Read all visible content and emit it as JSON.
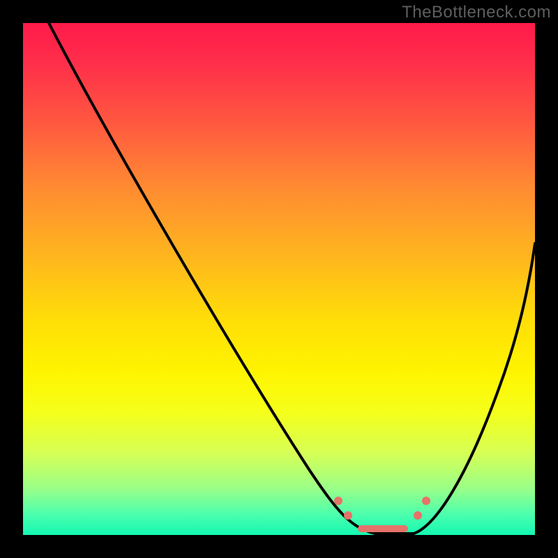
{
  "watermark": "TheBottleneck.com",
  "colors": {
    "frame": "#000000",
    "curve": "#000000",
    "marker": "#e57369",
    "watermark": "#5e5e5e"
  },
  "chart_data": {
    "type": "line",
    "title": "",
    "xlabel": "",
    "ylabel": "",
    "xlim": [
      0,
      100
    ],
    "ylim": [
      0,
      100
    ],
    "grid": false,
    "series": [
      {
        "name": "left-curve",
        "x": [
          5,
          12,
          20,
          28,
          36,
          44,
          52,
          58,
          62,
          66,
          70
        ],
        "y": [
          100,
          88,
          75,
          62,
          49,
          35,
          22,
          12,
          6,
          2,
          0
        ]
      },
      {
        "name": "right-curve",
        "x": [
          76,
          80,
          84,
          88,
          92,
          96,
          100
        ],
        "y": [
          0,
          4,
          12,
          22,
          33,
          45,
          57
        ]
      }
    ],
    "annotations": [
      {
        "name": "valley-marker-left-outer",
        "type": "dot",
        "x": 61.5,
        "y": 7
      },
      {
        "name": "valley-marker-left-inner",
        "type": "dot",
        "x": 63.5,
        "y": 4
      },
      {
        "name": "valley-center-band",
        "type": "line",
        "x0": 65.5,
        "x1": 75,
        "y": 1.3
      },
      {
        "name": "valley-marker-right-inner",
        "type": "dot",
        "x": 77,
        "y": 4
      },
      {
        "name": "valley-marker-right-outer",
        "type": "dot",
        "x": 78.5,
        "y": 7
      }
    ]
  }
}
